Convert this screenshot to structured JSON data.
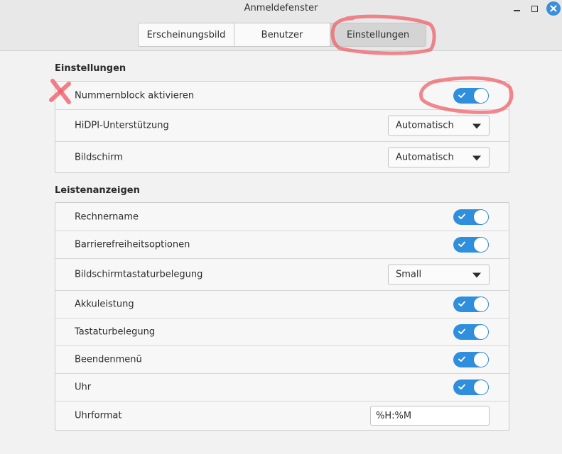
{
  "window": {
    "title": "Anmeldefenster",
    "controls": [
      "minimize-icon",
      "maximize-icon",
      "close-icon"
    ]
  },
  "tabs": [
    {
      "label": "Erscheinungsbild",
      "active": false
    },
    {
      "label": "Benutzer",
      "active": false
    },
    {
      "label": "Einstellungen",
      "active": true
    }
  ],
  "sections": {
    "einstellungen": {
      "title": "Einstellungen",
      "rows": [
        {
          "label": "Nummernblock aktivieren",
          "type": "switch",
          "value": true
        },
        {
          "label": "HiDPI-Unterstützung",
          "type": "combo",
          "value": "Automatisch"
        },
        {
          "label": "Bildschirm",
          "type": "combo",
          "value": "Automatisch"
        }
      ]
    },
    "leiste": {
      "title": "Leistenanzeigen",
      "rows": [
        {
          "label": "Rechnername",
          "type": "switch",
          "value": true
        },
        {
          "label": "Barrierefreiheitsoptionen",
          "type": "switch",
          "value": true
        },
        {
          "label": "Bildschirmtastaturbelegung",
          "type": "combo",
          "value": "Small"
        },
        {
          "label": "Akkuleistung",
          "type": "switch",
          "value": true
        },
        {
          "label": "Tastaturbelegung",
          "type": "switch",
          "value": true
        },
        {
          "label": "Beendenmenü",
          "type": "switch",
          "value": true
        },
        {
          "label": "Uhr",
          "type": "switch",
          "value": true
        },
        {
          "label": "Uhrformat",
          "type": "entry",
          "value": "%H:%M"
        }
      ]
    }
  },
  "colors": {
    "accent": "#2f8fdc",
    "annotation": "#f0606a"
  }
}
